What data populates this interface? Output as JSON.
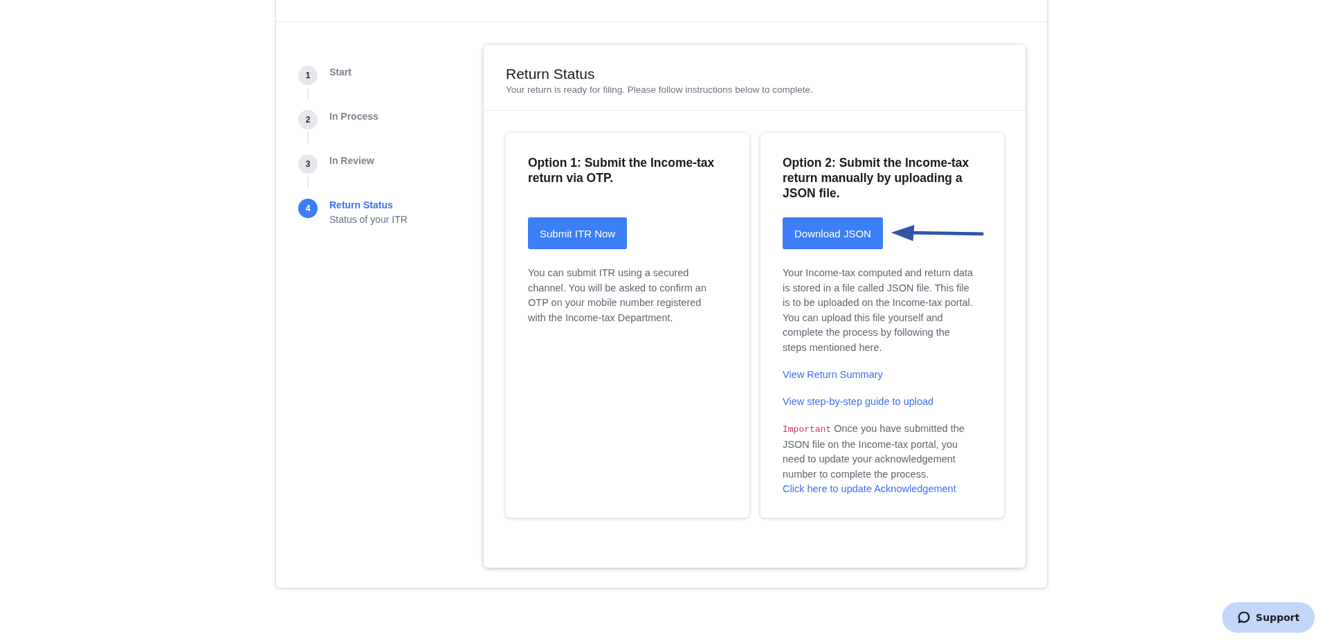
{
  "steps": [
    {
      "number": "1",
      "label": "Start",
      "selected": false
    },
    {
      "number": "2",
      "label": "In Process",
      "selected": false
    },
    {
      "number": "3",
      "label": "In Review",
      "selected": false
    },
    {
      "number": "4",
      "label": "Return Status",
      "subtitle": "Status of your ITR",
      "selected": true
    }
  ],
  "main": {
    "title": "Return Status",
    "subtitle": "Your return is ready for filing. Please follow instructions below to complete."
  },
  "options": [
    {
      "heading": "Option 1: Submit the Income-tax return via OTP.",
      "button": "Submit ITR Now",
      "description": "You can submit ITR using a secured channel. You will be asked to confirm an OTP on your mobile number registered with the Income-tax Department."
    },
    {
      "heading": "Option 2: Submit the Income-tax return manually by uploading a JSON file.",
      "button": "Download JSON",
      "pointer_arrow": true,
      "description": "Your Income-tax computed and return data is stored in a file called JSON file. This file is to be uploaded on the Income-tax portal. You can upload this file yourself and complete the process by following the steps mentioned here.",
      "links": [
        "View Return Summary",
        "View step-by-step guide to upload"
      ],
      "important": {
        "label": "Important",
        "text": "Once you have submitted the JSON file on the Income-tax portal, you need to update your acknowledgement number to complete the process.",
        "link": "Click here to update Acknowledgement"
      }
    }
  ],
  "support_button": "Support"
}
